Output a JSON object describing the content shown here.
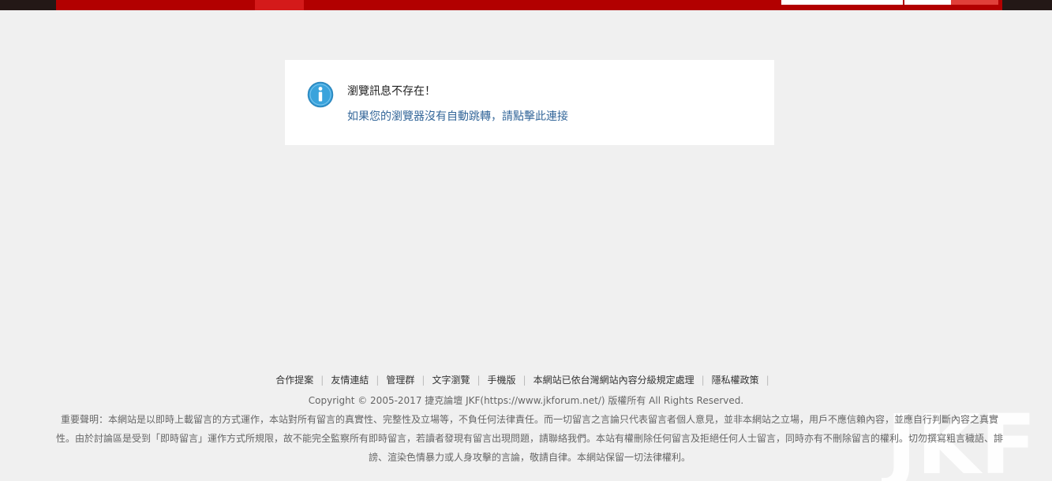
{
  "colors": {
    "topbar_dark": "#231816",
    "topbar_red": "#b20000",
    "topbar_active": "#d41a1a",
    "link_blue": "#336699",
    "info_icon": "#3aa3dc"
  },
  "message": {
    "icon": "info-icon",
    "title": "瀏覽訊息不存在！",
    "link_text": "如果您的瀏覽器沒有自動跳轉，請點擊此連接"
  },
  "footer": {
    "links": [
      "合作提案",
      "友情連結",
      "管理群",
      "文字瀏覽",
      "手機版",
      "本網站已依台灣網站內容分級規定處理",
      "隱私權政策"
    ],
    "copyright": "Copyright © 2005-2017 捷克論壇 JKF(https://www.jkforum.net/) 版權所有 All Rights Reserved.",
    "disclaimer": "重要聲明：本網站是以即時上載留言的方式運作，本站對所有留言的真實性、完整性及立場等，不負任何法律責任。而一切留言之言論只代表留言者個人意見，並非本網站之立場，用戶不應信賴內容，並應自行判斷內容之真實性。由於討論區是受到「即時留言」運作方式所規限，故不能完全監察所有即時留言，若讀者發現有留言出現問題，請聯絡我們。本站有權刪除任何留言及拒絕任何人士留言，同時亦有不刪除留言的權利。切勿撰寫粗言穢語、誹謗、渲染色情暴力或人身攻擊的言論，敬請自律。本網站保留一切法律權利。",
    "watermark": "JKF"
  }
}
